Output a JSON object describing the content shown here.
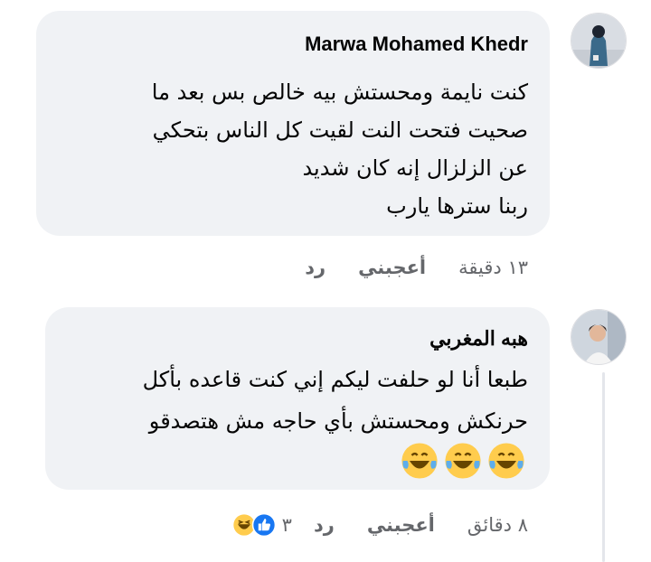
{
  "comments": [
    {
      "author": "Marwa Mohamed Khedr",
      "lines": [
        "كنت نايمة ومحستش بيه خالص بس بعد ما",
        "صحيت فتحت النت لقيت كل الناس بتحكي",
        "عن الزلزال إنه كان شديد",
        "ربنا سترها يارب"
      ],
      "time": "١٣ دقيقة",
      "like_label": "أعجبني",
      "reply_label": "رد"
    },
    {
      "author": "هبه المغربي",
      "lines": [
        "طبعا أنا لو حلفت ليكم إني كنت قاعده بأكل",
        "حرنكش ومحستش بأي حاجه مش هتصدقو"
      ],
      "emojis": [
        "laughing-tears",
        "laughing-tears",
        "laughing-tears"
      ],
      "time": "٨ دقائق",
      "like_label": "أعجبني",
      "reply_label": "رد",
      "reaction_count": "٣",
      "reactions": [
        "like",
        "haha"
      ]
    }
  ],
  "colors": {
    "bubble": "#f0f2f5",
    "meta": "#65676b",
    "like_blue": "#1877f2",
    "emoji_yellow": "#ffcc4d"
  }
}
